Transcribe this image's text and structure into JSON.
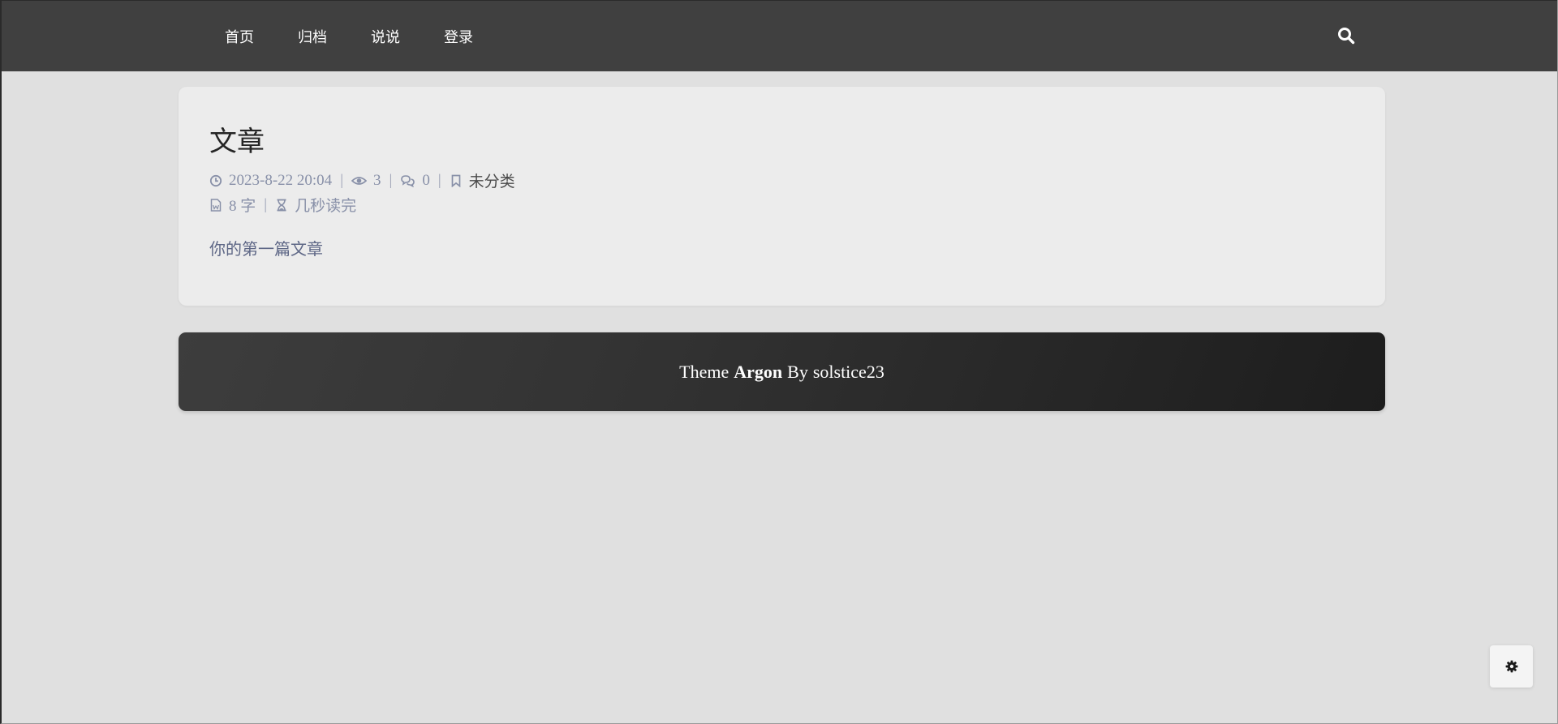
{
  "nav": {
    "items": [
      {
        "label": "首页"
      },
      {
        "label": "归档"
      },
      {
        "label": "说说"
      },
      {
        "label": "登录"
      }
    ],
    "search_icon": "search-icon"
  },
  "post": {
    "title": "文章",
    "date": "2023-8-22 20:04",
    "views": "3",
    "comments": "0",
    "category": "未分类",
    "word_count": "8 字",
    "read_time": "几秒读完",
    "excerpt": "你的第一篇文章"
  },
  "footer": {
    "prefix": "Theme",
    "theme_name": "Argon",
    "by": "By",
    "author": "solstice23"
  },
  "settings": {
    "icon": "gear-icon"
  },
  "colors": {
    "navbar": "#404040",
    "background": "#e0e0e0",
    "card": "#ececec",
    "meta": "#8890a8",
    "excerpt": "#5e6786"
  }
}
